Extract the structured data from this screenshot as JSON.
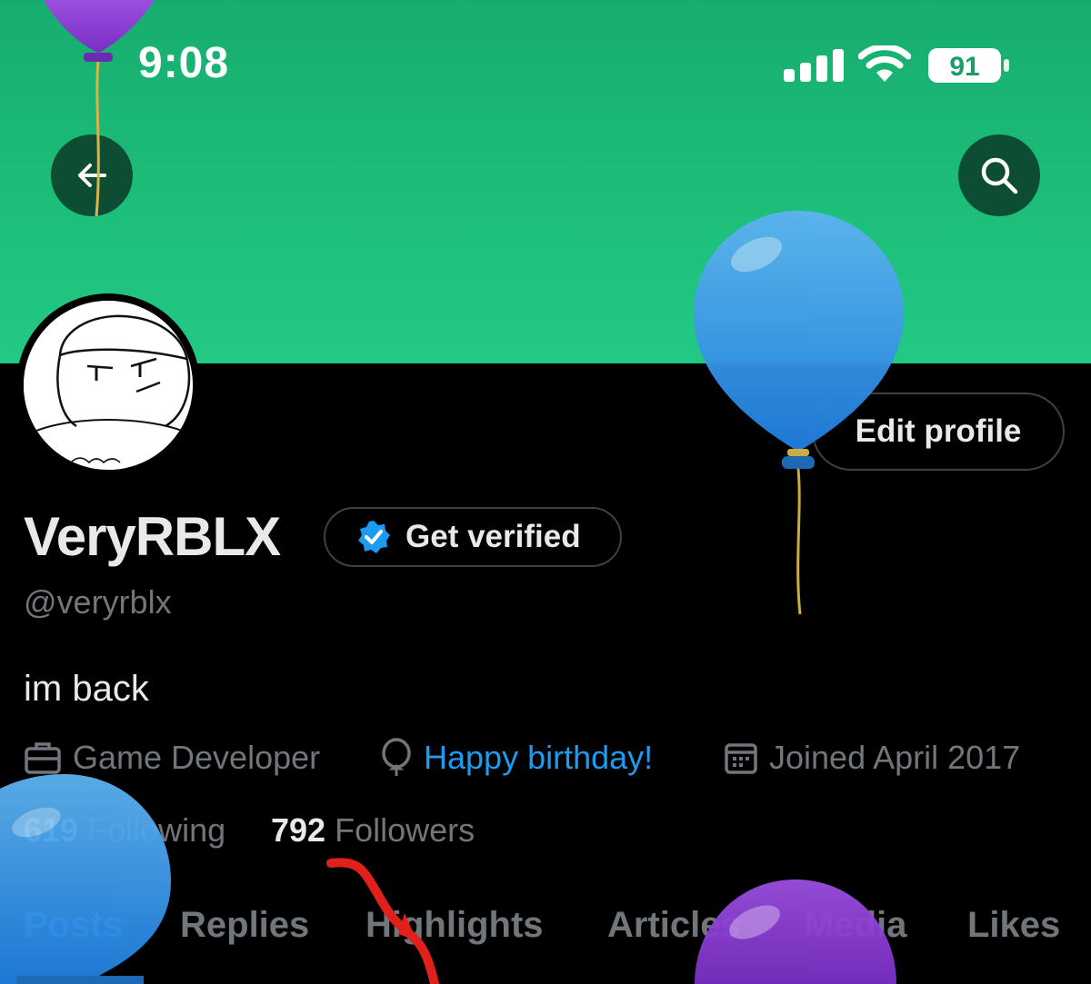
{
  "status_bar": {
    "time": "9:08",
    "battery": "91"
  },
  "profile": {
    "display_name": "VeryRBLX",
    "verify_label": "Get verified",
    "handle": "@veryrblx",
    "bio": "im back",
    "job": "Game Developer",
    "birthday": "Happy birthday!",
    "joined": "Joined April 2017",
    "following_count": "619",
    "following_label": "Following",
    "followers_count": "792",
    "followers_label": "Followers",
    "edit_label": "Edit profile"
  },
  "tabs": [
    "Posts",
    "Replies",
    "Highlights",
    "Articles",
    "Media",
    "Likes"
  ],
  "colors": {
    "banner": "#1dbf7a",
    "accent": "#1d9bf0",
    "balloon_blue": "#2f8fe0",
    "balloon_purple": "#8a3fd1",
    "annotation": "#e0201a"
  }
}
